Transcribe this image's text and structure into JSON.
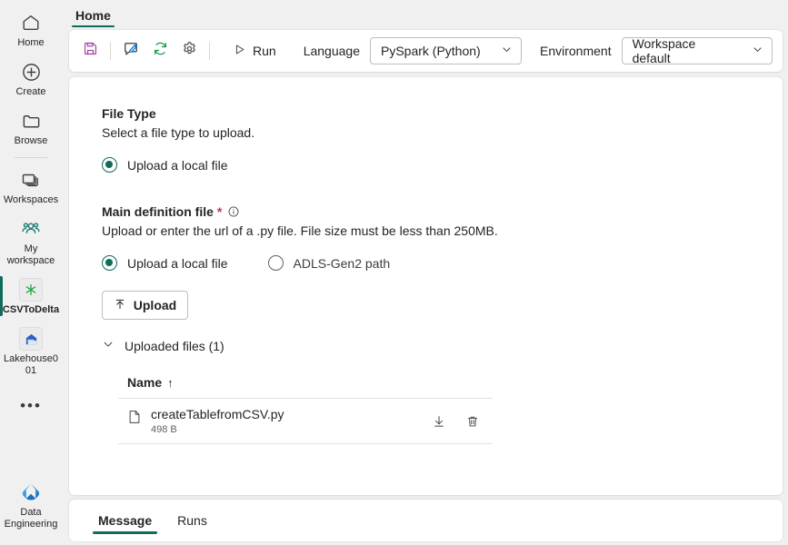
{
  "sidebar": {
    "items": [
      {
        "label": "Home",
        "icon": "home-icon"
      },
      {
        "label": "Create",
        "icon": "plus-circle-icon"
      },
      {
        "label": "Browse",
        "icon": "folder-icon"
      },
      {
        "label": "Workspaces",
        "icon": "workspaces-icon"
      },
      {
        "label": "My workspace",
        "icon": "people-icon"
      },
      {
        "label": "CSVToDelta",
        "icon": "spark-asterisk-icon"
      },
      {
        "label": "Lakehouse001",
        "icon": "lakehouse-icon"
      },
      {
        "label": "More",
        "icon": "ellipsis-icon"
      }
    ],
    "footer": {
      "label": "Data Engineering",
      "icon": "fabric-logo-icon"
    },
    "active_item": "CSVToDelta"
  },
  "top_tabs": [
    {
      "label": "Home",
      "active": true
    }
  ],
  "toolbar": {
    "icons": [
      {
        "name": "save-icon",
        "color": "#a64ca6"
      },
      {
        "name": "edit-comment-icon",
        "color": "#0f6cbd"
      },
      {
        "name": "refresh-icon",
        "color": "#1a9c4b"
      },
      {
        "name": "settings-gear-icon",
        "color": "#424242"
      }
    ],
    "run_label": "Run",
    "language_label": "Language",
    "language_value": "PySpark (Python)",
    "environment_label": "Environment",
    "environment_value": "Workspace default"
  },
  "form": {
    "file_type": {
      "title": "File Type",
      "description": "Select a file type to upload.",
      "options": [
        {
          "label": "Upload a local file",
          "selected": true
        }
      ]
    },
    "main_definition_file": {
      "title": "Main definition file",
      "required_marker": "*",
      "info_icon": "info-circle-icon",
      "description": "Upload or enter the url of a .py file. File size must be less than 250MB.",
      "options": [
        {
          "label": "Upload a local file",
          "selected": true
        },
        {
          "label": "ADLS-Gen2 path",
          "selected": false
        }
      ],
      "upload_button": "Upload",
      "uploaded_files_label": "Uploaded files (1)",
      "table": {
        "columns": [
          "Name"
        ],
        "sort_indicator": "↑",
        "rows": [
          {
            "icon": "document-icon",
            "name": "createTablefromCSV.py",
            "size": "498 B",
            "actions": [
              "download-icon",
              "delete-icon"
            ]
          }
        ]
      }
    }
  },
  "bottom_tabs": [
    {
      "label": "Message",
      "active": true
    },
    {
      "label": "Runs",
      "active": false
    }
  ],
  "colors": {
    "accent_teal": "#0f6b5c",
    "required_red": "#c4314b",
    "page_bg": "#f0f0f0",
    "card_bg": "#ffffff"
  }
}
